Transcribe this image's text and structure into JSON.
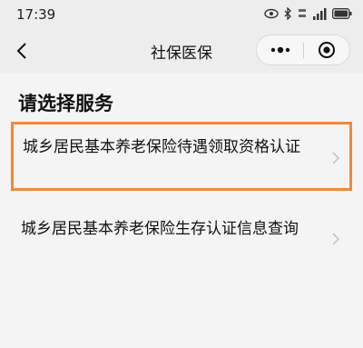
{
  "status_bar": {
    "time": "17:39",
    "icons": [
      "eye-icon",
      "bluetooth-icon",
      "data-speed-icon",
      "signal-icon",
      "battery-icon"
    ]
  },
  "nav": {
    "title": "社保医保",
    "back_icon": "chevron-left-icon",
    "more_icon": "more-dots-icon",
    "close_icon": "target-circle-icon"
  },
  "main": {
    "heading": "请选择服务",
    "services": [
      {
        "label": "城乡居民基本养老保险待遇领取资格认证",
        "selected": true
      },
      {
        "label": "城乡居民基本养老保险生存认证信息查询",
        "selected": false
      }
    ]
  },
  "colors": {
    "highlight": "#f0893a",
    "background": "#f4f4f4",
    "navbar": "#ededed"
  }
}
